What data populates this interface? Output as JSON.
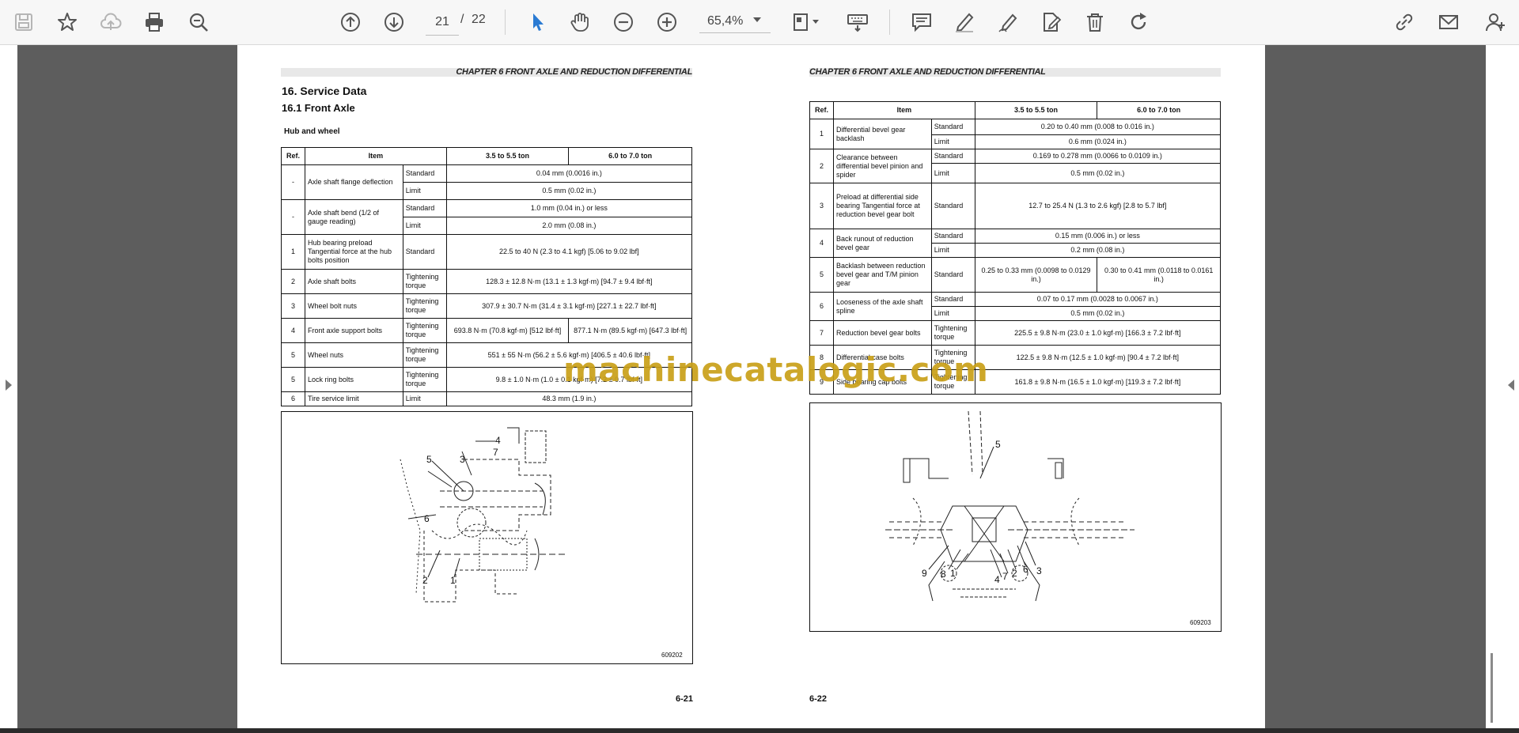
{
  "toolbar": {
    "page_current": "21",
    "page_separator": "/",
    "page_total": "22",
    "zoom": "65,4%",
    "icons": [
      "save-icon",
      "bookmark-star-icon",
      "cloud-upload-icon",
      "print-icon",
      "zoom-search-icon",
      "page-up-icon",
      "page-down-icon",
      "select-cursor-icon",
      "hand-pan-icon",
      "zoom-out-icon",
      "zoom-in-icon",
      "fit-page-icon",
      "keyboard-icon",
      "comment-icon",
      "highlight-pen-icon",
      "sign-pen-icon",
      "edit-document-icon",
      "delete-icon",
      "redo-icon",
      "link-icon",
      "email-icon",
      "add-user-icon"
    ],
    "accent_color": "#2b7bd3"
  },
  "left_page": {
    "chapter": "CHAPTER 6 FRONT AXLE AND REDUCTION DIFFERENTIAL",
    "section_title": "16.  Service Data",
    "subsection_title": "16.1    Front Axle",
    "table_title": "Hub and wheel",
    "headers": {
      "ref": "Ref.",
      "item": "Item",
      "col_a": "3.5 to 5.5 ton",
      "col_b": "6.0 to 7.0 ton"
    },
    "rows": [
      {
        "ref": "-",
        "item": "Axle shaft flange deflection",
        "sub": [
          "Standard",
          "Limit"
        ],
        "values": [
          "0.04 mm (0.0016 in.)",
          "0.5 mm (0.02 in.)"
        ]
      },
      {
        "ref": "-",
        "item": "Axle shaft bend (1/2 of gauge reading)",
        "sub": [
          "Standard",
          "Limit"
        ],
        "values": [
          "1.0 mm (0.04 in.) or less",
          "2.0 mm (0.08 in.)"
        ]
      },
      {
        "ref": "1",
        "item": "Hub bearing preload Tangential force at the hub bolts position",
        "sub": [
          "Standard"
        ],
        "values": [
          "22.5 to 40 N (2.3 to 4.1 kgf) [5.06 to 9.02 lbf]"
        ]
      },
      {
        "ref": "2",
        "item": "Axle shaft bolts",
        "sub": [
          "Tightening torque"
        ],
        "values": [
          "128.3 ± 12.8 N·m (13.1 ± 1.3 kgf·m) [94.7 ± 9.4 lbf·ft]"
        ]
      },
      {
        "ref": "3",
        "item": "Wheel bolt nuts",
        "sub": [
          "Tightening torque"
        ],
        "values": [
          "307.9 ± 30.7 N·m (31.4 ± 3.1 kgf·m) [227.1 ± 22.7 lbf·ft]"
        ]
      },
      {
        "ref": "4",
        "item": "Front axle support bolts",
        "sub": [
          "Tightening torque"
        ],
        "values_a": "693.8 N·m (70.8 kgf·m) [512 lbf·ft]",
        "values_b": "877.1 N·m (89.5 kgf·m) [647.3 lbf·ft]"
      },
      {
        "ref": "5",
        "item": "Wheel nuts",
        "sub": [
          "Tightening torque"
        ],
        "values": [
          "551 ± 55 N·m (56.2 ± 5.6 kgf·m) [406.5 ± 40.6 lbf·ft]"
        ]
      },
      {
        "ref": "5",
        "item": "Lock ring bolts",
        "sub": [
          "Tightening torque"
        ],
        "values": [
          "9.8 ± 1.0 N·m (1.0 ± 0.1 kgf·m) [7.2 ± 0.7 lbf·ft]"
        ]
      },
      {
        "ref": "6",
        "item": "Tire service limit",
        "sub": [
          "Limit"
        ],
        "values": [
          "48.3 mm (1.9 in.)"
        ]
      }
    ],
    "figure_callouts": [
      "4",
      "7",
      "5",
      "3",
      "6",
      "2",
      "1"
    ],
    "figure_number": "609202",
    "page_number": "6-21"
  },
  "right_page": {
    "chapter": "CHAPTER 6 FRONT AXLE AND REDUCTION DIFFERENTIAL",
    "headers": {
      "ref": "Ref.",
      "item": "Item",
      "col_a": "3.5 to 5.5 ton",
      "col_b": "6.0 to 7.0 ton"
    },
    "rows": [
      {
        "ref": "1",
        "item": "Differential bevel gear backlash",
        "sub": [
          "Standard",
          "Limit"
        ],
        "values": [
          "0.20 to 0.40 mm (0.008 to 0.016 in.)",
          "0.6 mm (0.024 in.)"
        ]
      },
      {
        "ref": "2",
        "item": "Clearance between differential bevel pinion and spider",
        "sub": [
          "Standard",
          "Limit"
        ],
        "values": [
          "0.169 to 0.278 mm (0.0066 to 0.0109 in.)",
          "0.5 mm (0.02 in.)"
        ]
      },
      {
        "ref": "3",
        "item": "Preload at differential side bearing Tangential force at reduction bevel gear bolt",
        "sub": [
          "Standard"
        ],
        "values": [
          "12.7 to 25.4 N (1.3 to 2.6 kgf) [2.8 to 5.7 lbf]"
        ]
      },
      {
        "ref": "4",
        "item": "Back runout of reduction bevel gear",
        "sub": [
          "Standard",
          "Limit"
        ],
        "values": [
          "0.15 mm (0.006 in.) or less",
          "0.2 mm (0.08 in.)"
        ]
      },
      {
        "ref": "5",
        "item": "Backlash between reduction bevel gear and T/M pinion gear",
        "sub": [
          "Standard"
        ],
        "values_a": "0.25 to 0.33 mm (0.0098 to 0.0129 in.)",
        "values_b": "0.30 to 0.41 mm (0.0118 to 0.0161 in.)"
      },
      {
        "ref": "6",
        "item": "Looseness of the axle shaft spline",
        "sub": [
          "Standard",
          "Limit"
        ],
        "values": [
          "0.07 to 0.17 mm (0.0028 to 0.0067 in.)",
          "0.5 mm (0.02 in.)"
        ]
      },
      {
        "ref": "7",
        "item": "Reduction bevel gear bolts",
        "sub": [
          "Tightening torque"
        ],
        "values": [
          "225.5 ± 9.8 N·m (23.0 ± 1.0 kgf·m) [166.3 ± 7.2 lbf·ft]"
        ]
      },
      {
        "ref": "8",
        "item": "Differential case bolts",
        "sub": [
          "Tightening torque"
        ],
        "values": [
          "122.5 ± 9.8 N·m (12.5 ± 1.0 kgf·m) [90.4 ± 7.2 lbf·ft]"
        ]
      },
      {
        "ref": "9",
        "item": "Side bearing cap bolts",
        "sub": [
          "Tightening torque"
        ],
        "values": [
          "161.8 ± 9.8 N·m (16.5 ± 1.0 kgf·m) [119.3 ± 7.2 lbf·ft]"
        ]
      }
    ],
    "figure_callouts": [
      "5",
      "9",
      "8",
      "1",
      "4",
      "7",
      "2",
      "6",
      "3"
    ],
    "figure_number": "609203",
    "page_number": "6-22"
  },
  "watermark": "machinecatalogic.com"
}
